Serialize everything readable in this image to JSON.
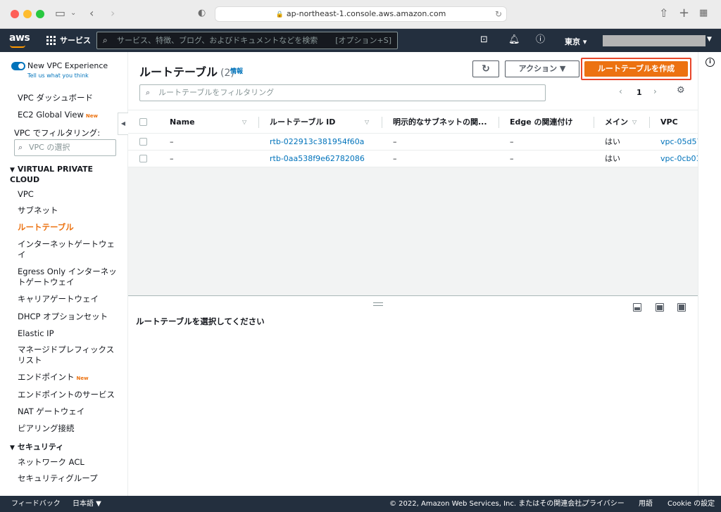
{
  "browser": {
    "url": "ap-northeast-1.console.aws.amazon.com"
  },
  "header": {
    "logo": "aws",
    "services": "サービス",
    "search_placeholder": "サービス、特徴、ブログ、およびドキュメントなどを検索",
    "search_shortcut": "[オプション+S]",
    "region": "東京 ▾"
  },
  "sidebar": {
    "new_vpc": "New VPC Experience",
    "tell_us": "Tell us what you think",
    "dashboard": "VPC ダッシュボード",
    "ec2_global": "EC2 Global View",
    "new_badge": "New",
    "filter_label": "VPC でフィルタリング:",
    "filter_placeholder": "VPC の選択",
    "section_vpc": "VIRTUAL PRIVATE CLOUD",
    "items": [
      "VPC",
      "サブネット",
      "ルートテーブル",
      "インターネットゲートウェイ",
      "Egress Only インターネットゲートウェイ",
      "キャリアゲートウェイ",
      "DHCP オプションセット",
      "Elastic IP",
      "マネージドプレフィックスリスト",
      "エンドポイント",
      "エンドポイントのサービス",
      "NAT ゲートウェイ",
      "ピアリング接続"
    ],
    "section_security": "セキュリティ",
    "security_items": [
      "ネットワーク ACL",
      "セキュリティグループ"
    ]
  },
  "main": {
    "title": "ルートテーブル",
    "count": "(2)",
    "info": "情報",
    "action_label": "アクション ▼",
    "create_label": "ルートテーブルを作成",
    "filter_placeholder": "ルートテーブルをフィルタリング",
    "page": "1",
    "columns": [
      "Name",
      "ルートテーブル ID",
      "明示的なサブネットの関...",
      "Edge の関連付け",
      "メイン",
      "VPC"
    ],
    "rows": [
      {
        "name": "–",
        "id": "rtb-022913c381954f60a",
        "subnet": "–",
        "edge": "–",
        "main": "はい",
        "vpc": "vpc-05d57"
      },
      {
        "name": "–",
        "id": "rtb-0aa538f9e62782086",
        "subnet": "–",
        "edge": "–",
        "main": "はい",
        "vpc": "vpc-0cb01"
      }
    ],
    "split_message": "ルートテーブルを選択してください"
  },
  "footer": {
    "feedback": "フィードバック",
    "language": "日本語 ▼",
    "copyright": "© 2022, Amazon Web Services, Inc. またはその関連会社。",
    "privacy": "プライバシー",
    "terms": "用語",
    "cookie": "Cookie の設定"
  }
}
